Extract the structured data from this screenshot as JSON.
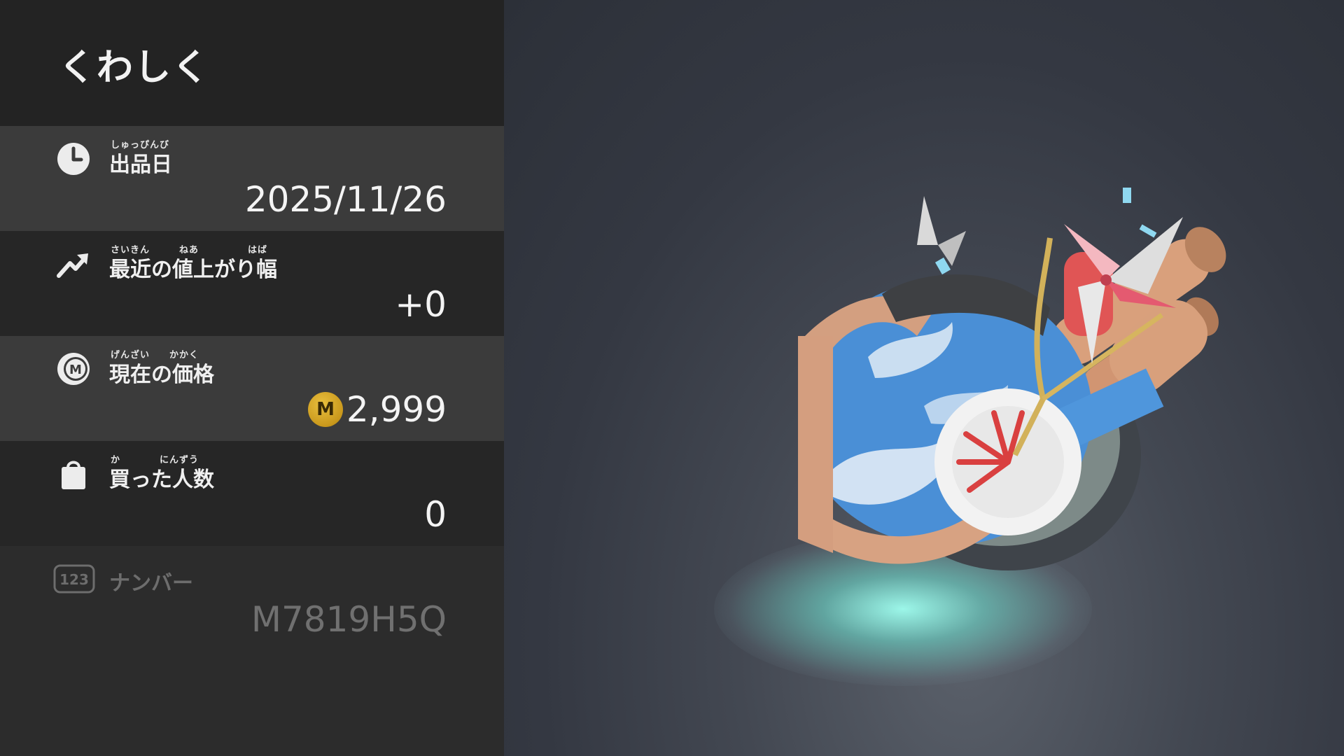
{
  "panel": {
    "title": "くわしく",
    "rows": [
      {
        "ruby": "しゅっぴんび",
        "label": "出品日",
        "value": "2025/11/26",
        "icon": "clock-icon"
      },
      {
        "ruby": "さいきん　　　ねあ　　　　　はば",
        "label": "最近の値上がり幅",
        "value": "+0",
        "icon": "trend-up-icon"
      },
      {
        "ruby": "げんざい　　かかく",
        "label": "現在の価格",
        "value": "2,999",
        "icon": "m-coin-icon",
        "currency": "M"
      },
      {
        "ruby": "か　　　　にんずう",
        "label": "買った人数",
        "value": "0",
        "icon": "shopping-bag-icon"
      },
      {
        "ruby": "",
        "label": "ナンバー",
        "value": "M7819H5Q",
        "icon": "number-123-icon",
        "icon_text": "123"
      }
    ]
  },
  "colors": {
    "panel_bg": "#2c2c2c",
    "row_light": "#3b3b3b",
    "row_dark": "#262626",
    "coin_gold": "#c9981c",
    "spotlight": "#a0fff0"
  }
}
